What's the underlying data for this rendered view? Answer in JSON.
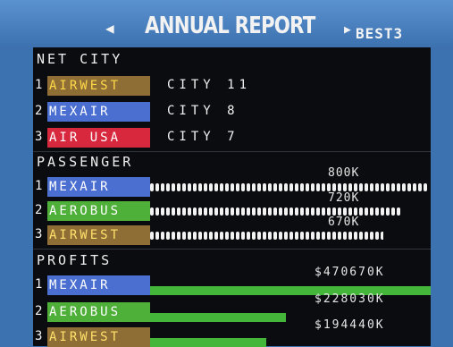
{
  "header": {
    "arrow_left": "◀",
    "title": "ANNUAL REPORT",
    "arrow_right": "▶",
    "subtitle": "BEST3"
  },
  "net_city": {
    "heading": "NET CITY",
    "rows": [
      {
        "rank": "1",
        "name": "AIRWEST",
        "value": "CITY 11",
        "color": "#8f6e36"
      },
      {
        "rank": "2",
        "name": "MEXAIR",
        "value": "CITY 8",
        "color": "#4b6fd0"
      },
      {
        "rank": "3",
        "name": "AIR USA",
        "value": "CITY 7",
        "color": "#d8283e"
      }
    ]
  },
  "passenger": {
    "heading": "PASSENGER",
    "rows": [
      {
        "rank": "1",
        "name": "MEXAIR",
        "value": "800K",
        "amount": 800,
        "color": "#4b6fd0"
      },
      {
        "rank": "2",
        "name": "AEROBUS",
        "value": "720K",
        "amount": 720,
        "color": "#4eaf39"
      },
      {
        "rank": "3",
        "name": "AIRWEST",
        "value": "670K",
        "amount": 670,
        "color": "#8f6e36"
      }
    ]
  },
  "profits": {
    "heading": "PROFITS",
    "rows": [
      {
        "rank": "1",
        "name": "MEXAIR",
        "value": "$470670K",
        "amount": 470670,
        "color": "#4b6fd0"
      },
      {
        "rank": "2",
        "name": "AEROBUS",
        "value": "$228030K",
        "amount": 228030,
        "color": "#4eaf39"
      },
      {
        "rank": "3",
        "name": "AIRWEST",
        "value": "$194440K",
        "amount": 194440,
        "color": "#8f6e36"
      }
    ]
  }
}
